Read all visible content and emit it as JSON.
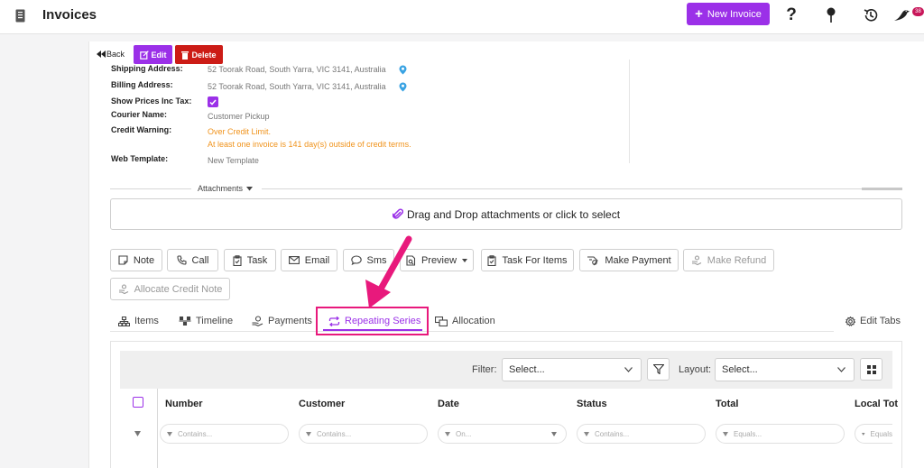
{
  "header": {
    "title": "Invoices",
    "new_invoice_label": "New Invoice",
    "help_glyph": "?",
    "notification_count": "38"
  },
  "toolbar": {
    "back_label": "Back",
    "edit_label": "Edit",
    "delete_label": "Delete"
  },
  "details": {
    "shipping_label": "Shipping Address:",
    "shipping_value": "52 Toorak Road, South Yarra, VIC 3141, Australia",
    "billing_label": "Billing Address:",
    "billing_value": "52 Toorak Road, South Yarra, VIC 3141, Australia",
    "show_prices_label": "Show Prices Inc Tax:",
    "show_prices_checked": true,
    "courier_label": "Courier Name:",
    "courier_value": "Customer Pickup",
    "credit_warning_label": "Credit Warning:",
    "credit_warning_line1": "Over Credit Limit.",
    "credit_warning_line2": "At least one invoice is 141 day(s) outside of credit terms.",
    "web_template_label": "Web Template:",
    "web_template_value": "New Template"
  },
  "attachments": {
    "label": "Attachments",
    "drop_text": "Drag and Drop attachments or click to select"
  },
  "actions": {
    "note": "Note",
    "call": "Call",
    "task": "Task",
    "email": "Email",
    "sms": "Sms",
    "preview": "Preview",
    "task_for_items": "Task For Items",
    "make_payment": "Make Payment",
    "make_refund": "Make Refund",
    "allocate_credit_note": "Allocate Credit Note"
  },
  "tabs": {
    "items": "Items",
    "timeline": "Timeline",
    "payments": "Payments",
    "repeating_series": "Repeating Series",
    "allocation": "Allocation",
    "edit_tabs": "Edit Tabs",
    "active": "repeating_series"
  },
  "grid": {
    "filter_label": "Filter:",
    "filter_placeholder": "Select...",
    "layout_label": "Layout:",
    "layout_placeholder": "Select...",
    "columns": [
      "Number",
      "Customer",
      "Date",
      "Status",
      "Total",
      "Local Tot"
    ],
    "column_filters": [
      "Contains...",
      "Contains...",
      "On...",
      "Contains...",
      "Equals...",
      "Equals"
    ]
  },
  "colors": {
    "accent": "#9b30e8",
    "danger": "#cc1c16",
    "warning": "#f0931c",
    "highlight": "#e8197c"
  }
}
